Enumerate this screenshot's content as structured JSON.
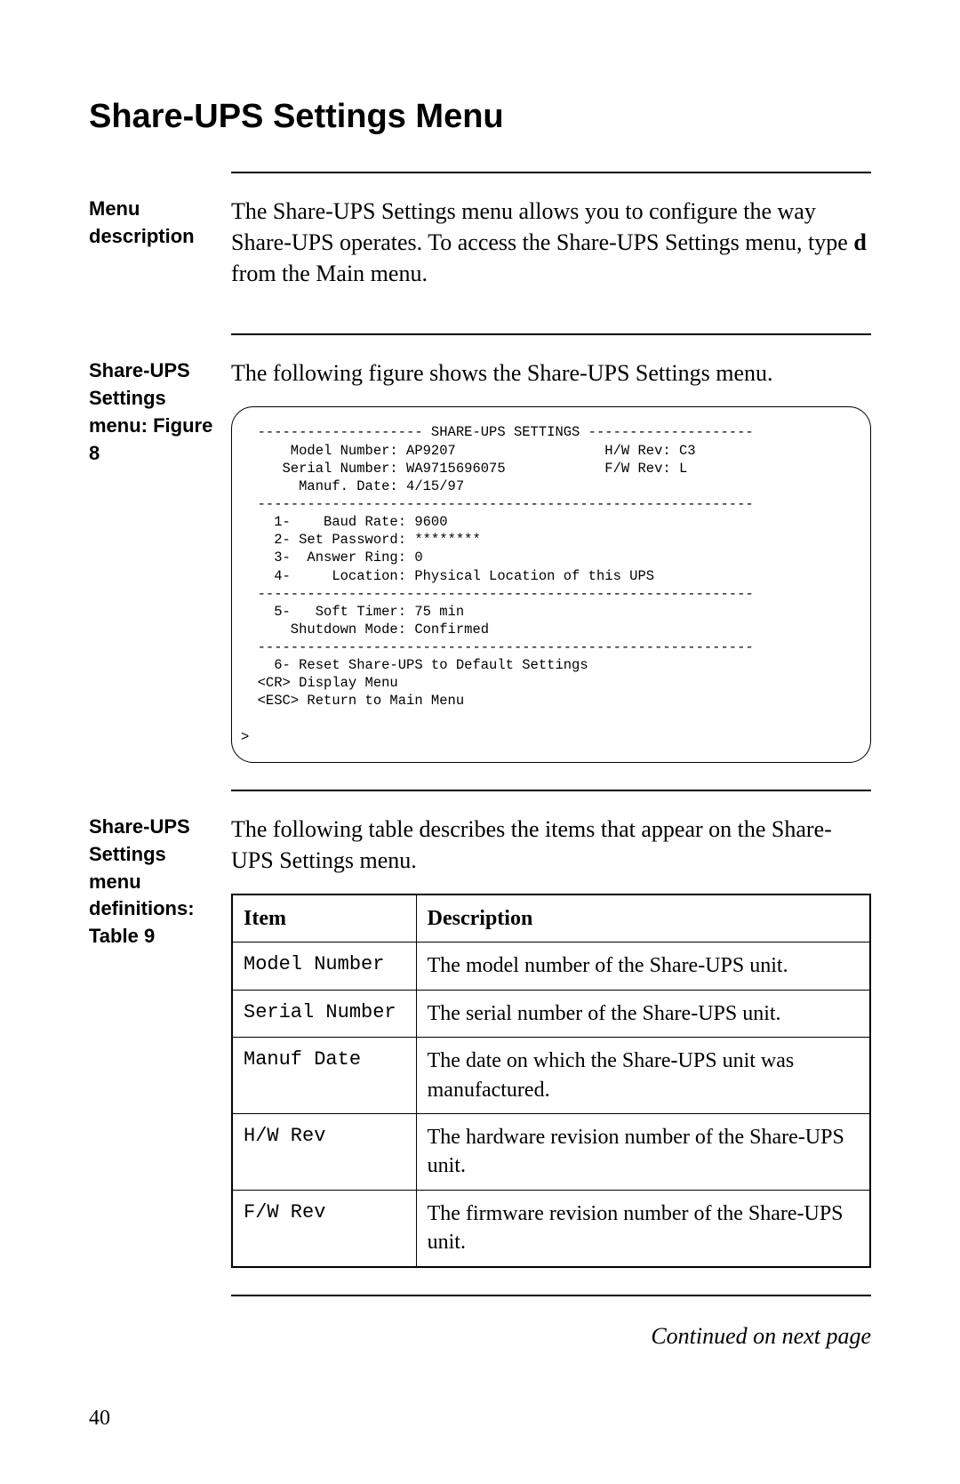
{
  "title": "Share-UPS Settings Menu",
  "page_number": "40",
  "continued": "Continued on next page",
  "sections": {
    "menu_description": {
      "label": "Menu description",
      "body_pre": "The Share-UPS Settings menu allows you to configure the way Share-UPS operates. To access the Share-UPS Settings menu, type ",
      "body_bold": "d",
      "body_post": " from the Main menu."
    },
    "figure": {
      "label": "Share-UPS Settings menu: Figure 8",
      "intro": "The following figure shows the Share-UPS Settings menu.",
      "text": "  -------------------- SHARE-UPS SETTINGS --------------------\n      Model Number: AP9207                  H/W Rev: C3\n     Serial Number: WA9715696075            F/W Rev: L\n       Manuf. Date: 4/15/97\n  ------------------------------------------------------------\n    1-    Baud Rate: 9600\n    2- Set Password: ********\n    3-  Answer Ring: 0\n    4-     Location: Physical Location of this UPS\n  ------------------------------------------------------------\n    5-   Soft Timer: 75 min\n      Shutdown Mode: Confirmed\n  ------------------------------------------------------------\n    6- Reset Share-UPS to Default Settings\n  <CR> Display Menu\n  <ESC> Return to Main Menu\n\n>"
    },
    "table": {
      "label": "Share-UPS Settings menu definitions: Table 9",
      "intro": "The following table describes the items that appear on the Share-UPS Settings menu.",
      "headers": {
        "item": "Item",
        "description": "Description"
      },
      "rows": [
        {
          "item": "Model Number",
          "desc": "The model number of the Share-UPS unit."
        },
        {
          "item": "Serial Number",
          "desc": "The serial number of the Share-UPS unit."
        },
        {
          "item": "Manuf Date",
          "desc": "The date on which the Share-UPS unit was manufactured."
        },
        {
          "item": "H/W Rev",
          "desc": "The hardware revision number of the Share-UPS unit."
        },
        {
          "item": "F/W Rev",
          "desc": "The firmware revision number of the Share-UPS unit."
        }
      ]
    }
  }
}
